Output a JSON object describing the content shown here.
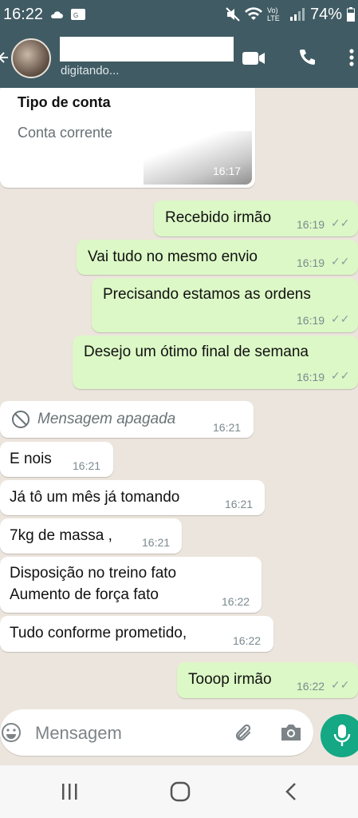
{
  "status_bar": {
    "time": "16:22",
    "battery": "74%",
    "network": "Vo) LTE"
  },
  "header": {
    "contact_status": "digitando..."
  },
  "messages": [
    {
      "dir": "in",
      "title": "Tipo de conta",
      "text": "Conta corrente",
      "time": "16:17"
    },
    {
      "dir": "out",
      "text": "Recebido irmão",
      "time": "16:19"
    },
    {
      "dir": "out",
      "text": "Vai tudo no mesmo envio",
      "time": "16:19"
    },
    {
      "dir": "out",
      "text": "Precisando estamos as ordens",
      "time": "16:19"
    },
    {
      "dir": "out",
      "text": "Desejo um ótimo final de semana",
      "time": "16:19"
    },
    {
      "dir": "in",
      "deleted": true,
      "text": "Mensagem apagada",
      "time": "16:21"
    },
    {
      "dir": "in",
      "text": "E nois",
      "time": "16:21"
    },
    {
      "dir": "in",
      "text": "Já tô um mês já tomando",
      "time": "16:21"
    },
    {
      "dir": "in",
      "text": "7kg de massa ,",
      "time": "16:21"
    },
    {
      "dir": "in",
      "text_lines": [
        "Disposição no treino fato",
        "Aumento de força fato"
      ],
      "time": "16:22"
    },
    {
      "dir": "in",
      "text": "Tudo conforme prometido,",
      "time": "16:22"
    },
    {
      "dir": "out",
      "text": "Tooop irmão",
      "time": "16:22"
    }
  ],
  "composer": {
    "placeholder": "Mensagem"
  },
  "icons": {
    "back": "back-arrow-icon",
    "video": "video-call-icon",
    "call": "phone-icon",
    "menu": "more-vert-icon",
    "emoji": "emoji-icon",
    "attach": "paperclip-icon",
    "camera": "camera-icon",
    "mic": "mic-icon",
    "recent": "recent-apps-icon",
    "home": "home-icon",
    "nav_back": "nav-back-icon"
  },
  "colors": {
    "header": "#405b63",
    "chat_bg": "#ece5dd",
    "outgoing": "#dcf8c6",
    "incoming": "#ffffff",
    "accent": "#14a884"
  }
}
